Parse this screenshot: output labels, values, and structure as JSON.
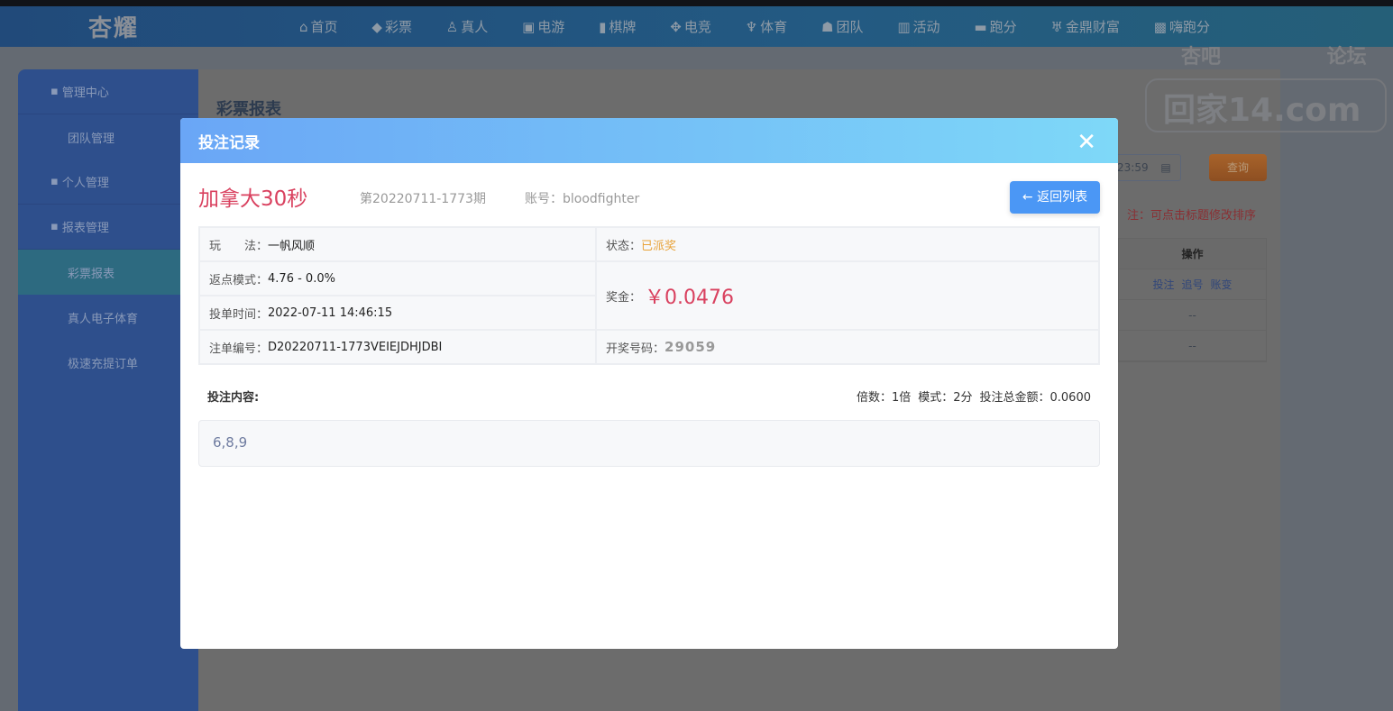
{
  "nav": {
    "logo": "杏耀",
    "items": [
      {
        "icon": "home-icon",
        "glyph": "⌂",
        "label": "首页"
      },
      {
        "icon": "lottery-icon",
        "glyph": "◆",
        "label": "彩票"
      },
      {
        "icon": "live-icon",
        "glyph": "♙",
        "label": "真人"
      },
      {
        "icon": "slot-icon",
        "glyph": "▣",
        "label": "电游"
      },
      {
        "icon": "cards-icon",
        "glyph": "▮",
        "label": "棋牌"
      },
      {
        "icon": "gamepad-icon",
        "glyph": "✥",
        "label": "电竞"
      },
      {
        "icon": "trophy-icon",
        "glyph": "♆",
        "label": "体育"
      },
      {
        "icon": "team-icon",
        "glyph": "☗",
        "label": "团队"
      },
      {
        "icon": "gift-icon",
        "glyph": "▥",
        "label": "活动"
      },
      {
        "icon": "rhino-icon",
        "glyph": "▬",
        "label": "跑分"
      },
      {
        "icon": "cauldron-icon",
        "glyph": "♅",
        "label": "金鼎财富"
      },
      {
        "icon": "hi-icon",
        "glyph": "▩",
        "label": "嗨跑分"
      }
    ]
  },
  "sidebar": {
    "items": [
      {
        "type": "head",
        "icon": "team-icon",
        "label": "管理中心"
      },
      {
        "type": "sub",
        "label": "团队管理"
      },
      {
        "type": "head",
        "icon": "user-icon",
        "label": "个人管理"
      },
      {
        "type": "head",
        "icon": "report-icon",
        "label": "报表管理"
      },
      {
        "type": "sub",
        "label": "彩票报表",
        "active": true
      },
      {
        "type": "sub",
        "label": "真人电子体育"
      },
      {
        "type": "sub",
        "label": "极速充提订单"
      }
    ]
  },
  "main": {
    "title": "彩票报表",
    "date_value": "23:59",
    "query_label": "查询",
    "note": "注：可点击标题修改排序",
    "table": {
      "header": "操作",
      "rows": [
        [
          "投注",
          "追号",
          "账变"
        ],
        [
          "--"
        ],
        [
          "--"
        ]
      ]
    }
  },
  "watermark": {
    "top": "杏吧 论坛",
    "main": "回家14.com"
  },
  "modal": {
    "title": "投注记录",
    "game": "加拿大30秒",
    "issue": "第20220711-1773期",
    "account": "账号：bloodfighter",
    "back_label": "返回列表",
    "play_label": "玩　　法：",
    "play": "一帆风顺",
    "status_label": "状态：",
    "status": "已派奖",
    "rebate_label": "返点模式：",
    "rebate": "4.76 - 0.0%",
    "prize_label": "奖金：",
    "prize": "￥0.0476",
    "time_label": "投单时间：",
    "time": "2022-07-11 14:46:15",
    "order_label": "注单编号：",
    "order": "D20220711-1773VEIEJDHJDBI",
    "draw_label": "开奖号码：",
    "draw": "29059",
    "content_label": "投注内容:",
    "multiple": "倍数：1倍",
    "mode": "模式：2分",
    "total": "投注总金额：0.0600",
    "content": "6,8,9",
    "colors": {
      "accent": "#4b97f5",
      "prize": "#d9415f",
      "status": "#e8a33a"
    }
  }
}
